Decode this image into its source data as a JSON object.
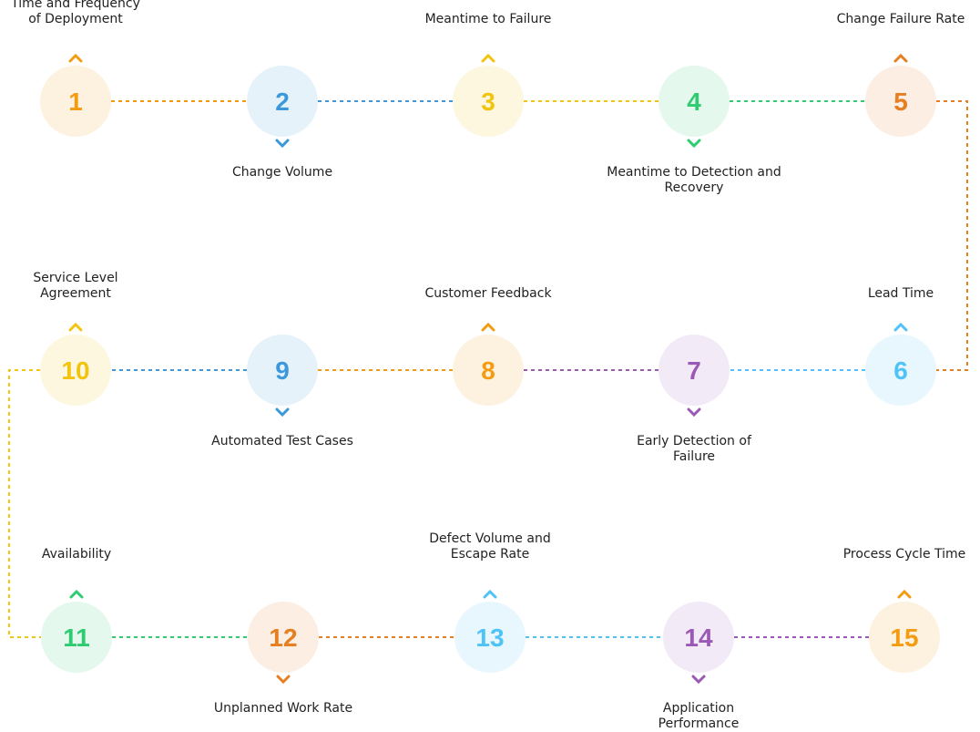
{
  "colors": {
    "orange": "#f39c12",
    "blue": "#3a98db",
    "yellow": "#f1c40f",
    "green": "#2ecc71",
    "darkorange": "#e67e22",
    "lightblue": "#4fc3f7",
    "purple": "#9b59b6"
  },
  "steps": [
    {
      "number": "1",
      "label": [
        "Time and Frequency",
        "of Deployment"
      ],
      "color": "orange",
      "label_side": "above",
      "chevron": "chevron-up-icon"
    },
    {
      "number": "2",
      "label": [
        "Change Volume"
      ],
      "color": "blue",
      "label_side": "below",
      "chevron": "chevron-down-icon"
    },
    {
      "number": "3",
      "label": [
        "Meantime to Failure"
      ],
      "color": "yellow",
      "label_side": "above",
      "chevron": "chevron-up-icon"
    },
    {
      "number": "4",
      "label": [
        "Meantime to Detection and",
        "Recovery"
      ],
      "color": "green",
      "label_side": "below",
      "chevron": "chevron-down-icon"
    },
    {
      "number": "5",
      "label": [
        "Change Failure Rate"
      ],
      "color": "darkorange",
      "label_side": "above",
      "chevron": "chevron-up-icon"
    },
    {
      "number": "6",
      "label": [
        "Lead Time"
      ],
      "color": "lightblue",
      "label_side": "above",
      "chevron": "chevron-up-icon"
    },
    {
      "number": "7",
      "label": [
        "Early Detection of",
        "Failure"
      ],
      "color": "purple",
      "label_side": "below",
      "chevron": "chevron-down-icon"
    },
    {
      "number": "8",
      "label": [
        "Customer Feedback"
      ],
      "color": "orange",
      "label_side": "above",
      "chevron": "chevron-up-icon"
    },
    {
      "number": "9",
      "label": [
        "Automated Test Cases"
      ],
      "color": "blue",
      "label_side": "below",
      "chevron": "chevron-down-icon"
    },
    {
      "number": "10",
      "label": [
        "Service  Level",
        "Agreement"
      ],
      "color": "yellow",
      "label_side": "above",
      "chevron": "chevron-up-icon"
    },
    {
      "number": "11",
      "label": [
        "Availability"
      ],
      "color": "green",
      "label_side": "above",
      "chevron": "chevron-up-icon"
    },
    {
      "number": "12",
      "label": [
        "Unplanned Work Rate"
      ],
      "color": "darkorange",
      "label_side": "below",
      "chevron": "chevron-down-icon"
    },
    {
      "number": "13",
      "label": [
        "Defect Volume and",
        "Escape Rate"
      ],
      "color": "lightblue",
      "label_side": "above",
      "chevron": "chevron-up-icon"
    },
    {
      "number": "14",
      "label": [
        "Application",
        "Performance"
      ],
      "color": "purple",
      "label_side": "below",
      "chevron": "chevron-down-icon"
    },
    {
      "number": "15",
      "label": [
        "Process Cycle Time"
      ],
      "color": "orange",
      "label_side": "above",
      "chevron": "chevron-up-icon"
    }
  ]
}
